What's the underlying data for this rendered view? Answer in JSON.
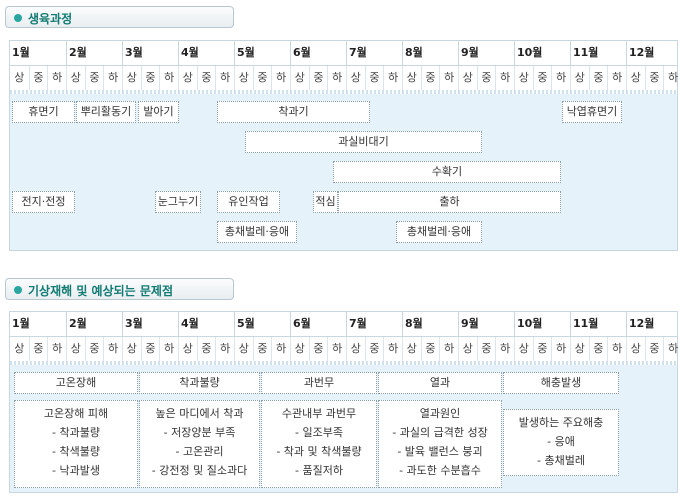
{
  "sections": {
    "growth": {
      "title": "생육과정"
    },
    "weather": {
      "title": "기상재해 및 예상되는 문제점"
    }
  },
  "months": [
    "1월",
    "2월",
    "3월",
    "4월",
    "5월",
    "6월",
    "7월",
    "8월",
    "9월",
    "10월",
    "11월",
    "12월"
  ],
  "subperiods": [
    "상",
    "중",
    "하"
  ],
  "growth_stages": {
    "dormancy": "휴면기",
    "root_activity": "뿌리활동기",
    "sprouting": "발아기",
    "fruiting": "착과기",
    "fruit_enlargement": "과실비대기",
    "harvest": "수확기",
    "leaf_fall_dormancy": "낙엽휴면기",
    "pruning": "전지·전정",
    "bud_thinning": "눈그누기",
    "training": "유인작업",
    "thinning": "적심",
    "shipping": "출하",
    "pest_1": "총채벌레·응애",
    "pest_2": "총채벌레·응애"
  },
  "issues": {
    "headers": [
      "고온장해",
      "착과불량",
      "과번무",
      "열과",
      "해충발생"
    ],
    "details": [
      [
        "고온장해 피해",
        "- 착과불량",
        "- 착색불량",
        "- 낙과발생"
      ],
      [
        "높은 마디에서 착과",
        "- 저장양분 부족",
        "- 고온관리",
        "- 강전정 및 질소과다"
      ],
      [
        "수관내부 과번무",
        "- 일조부족",
        "- 착과 및 착색불량",
        "- 품질저하"
      ],
      [
        "열과원인",
        "- 과실의 급격한 성장",
        "- 발육 밸런스 붕괴",
        "- 과도한 수분흡수"
      ],
      [
        "발생하는 주요해충",
        "- 응애",
        "- 총채벌레"
      ]
    ]
  }
}
